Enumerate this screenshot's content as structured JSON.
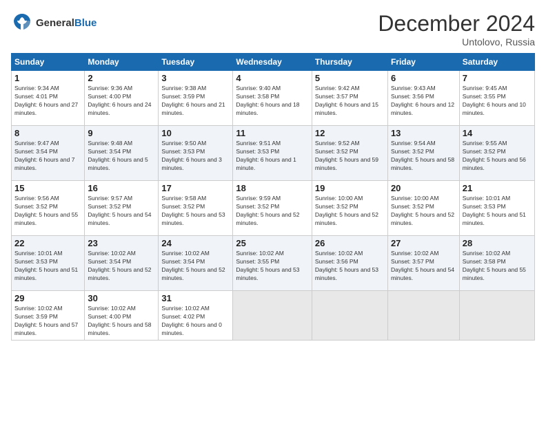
{
  "logo": {
    "general": "General",
    "blue": "Blue"
  },
  "title": "December 2024",
  "subtitle": "Untolovo, Russia",
  "days_header": [
    "Sunday",
    "Monday",
    "Tuesday",
    "Wednesday",
    "Thursday",
    "Friday",
    "Saturday"
  ],
  "weeks": [
    [
      {
        "num": "1",
        "rise": "9:34 AM",
        "set": "4:01 PM",
        "daylight": "6 hours and 27 minutes."
      },
      {
        "num": "2",
        "rise": "9:36 AM",
        "set": "4:00 PM",
        "daylight": "6 hours and 24 minutes."
      },
      {
        "num": "3",
        "rise": "9:38 AM",
        "set": "3:59 PM",
        "daylight": "6 hours and 21 minutes."
      },
      {
        "num": "4",
        "rise": "9:40 AM",
        "set": "3:58 PM",
        "daylight": "6 hours and 18 minutes."
      },
      {
        "num": "5",
        "rise": "9:42 AM",
        "set": "3:57 PM",
        "daylight": "6 hours and 15 minutes."
      },
      {
        "num": "6",
        "rise": "9:43 AM",
        "set": "3:56 PM",
        "daylight": "6 hours and 12 minutes."
      },
      {
        "num": "7",
        "rise": "9:45 AM",
        "set": "3:55 PM",
        "daylight": "6 hours and 10 minutes."
      }
    ],
    [
      {
        "num": "8",
        "rise": "9:47 AM",
        "set": "3:54 PM",
        "daylight": "6 hours and 7 minutes."
      },
      {
        "num": "9",
        "rise": "9:48 AM",
        "set": "3:54 PM",
        "daylight": "6 hours and 5 minutes."
      },
      {
        "num": "10",
        "rise": "9:50 AM",
        "set": "3:53 PM",
        "daylight": "6 hours and 3 minutes."
      },
      {
        "num": "11",
        "rise": "9:51 AM",
        "set": "3:53 PM",
        "daylight": "6 hours and 1 minute."
      },
      {
        "num": "12",
        "rise": "9:52 AM",
        "set": "3:52 PM",
        "daylight": "5 hours and 59 minutes."
      },
      {
        "num": "13",
        "rise": "9:54 AM",
        "set": "3:52 PM",
        "daylight": "5 hours and 58 minutes."
      },
      {
        "num": "14",
        "rise": "9:55 AM",
        "set": "3:52 PM",
        "daylight": "5 hours and 56 minutes."
      }
    ],
    [
      {
        "num": "15",
        "rise": "9:56 AM",
        "set": "3:52 PM",
        "daylight": "5 hours and 55 minutes."
      },
      {
        "num": "16",
        "rise": "9:57 AM",
        "set": "3:52 PM",
        "daylight": "5 hours and 54 minutes."
      },
      {
        "num": "17",
        "rise": "9:58 AM",
        "set": "3:52 PM",
        "daylight": "5 hours and 53 minutes."
      },
      {
        "num": "18",
        "rise": "9:59 AM",
        "set": "3:52 PM",
        "daylight": "5 hours and 52 minutes."
      },
      {
        "num": "19",
        "rise": "10:00 AM",
        "set": "3:52 PM",
        "daylight": "5 hours and 52 minutes."
      },
      {
        "num": "20",
        "rise": "10:00 AM",
        "set": "3:52 PM",
        "daylight": "5 hours and 52 minutes."
      },
      {
        "num": "21",
        "rise": "10:01 AM",
        "set": "3:53 PM",
        "daylight": "5 hours and 51 minutes."
      }
    ],
    [
      {
        "num": "22",
        "rise": "10:01 AM",
        "set": "3:53 PM",
        "daylight": "5 hours and 51 minutes."
      },
      {
        "num": "23",
        "rise": "10:02 AM",
        "set": "3:54 PM",
        "daylight": "5 hours and 52 minutes."
      },
      {
        "num": "24",
        "rise": "10:02 AM",
        "set": "3:54 PM",
        "daylight": "5 hours and 52 minutes."
      },
      {
        "num": "25",
        "rise": "10:02 AM",
        "set": "3:55 PM",
        "daylight": "5 hours and 53 minutes."
      },
      {
        "num": "26",
        "rise": "10:02 AM",
        "set": "3:56 PM",
        "daylight": "5 hours and 53 minutes."
      },
      {
        "num": "27",
        "rise": "10:02 AM",
        "set": "3:57 PM",
        "daylight": "5 hours and 54 minutes."
      },
      {
        "num": "28",
        "rise": "10:02 AM",
        "set": "3:58 PM",
        "daylight": "5 hours and 55 minutes."
      }
    ],
    [
      {
        "num": "29",
        "rise": "10:02 AM",
        "set": "3:59 PM",
        "daylight": "5 hours and 57 minutes."
      },
      {
        "num": "30",
        "rise": "10:02 AM",
        "set": "4:00 PM",
        "daylight": "5 hours and 58 minutes."
      },
      {
        "num": "31",
        "rise": "10:02 AM",
        "set": "4:02 PM",
        "daylight": "6 hours and 0 minutes."
      },
      null,
      null,
      null,
      null
    ]
  ]
}
